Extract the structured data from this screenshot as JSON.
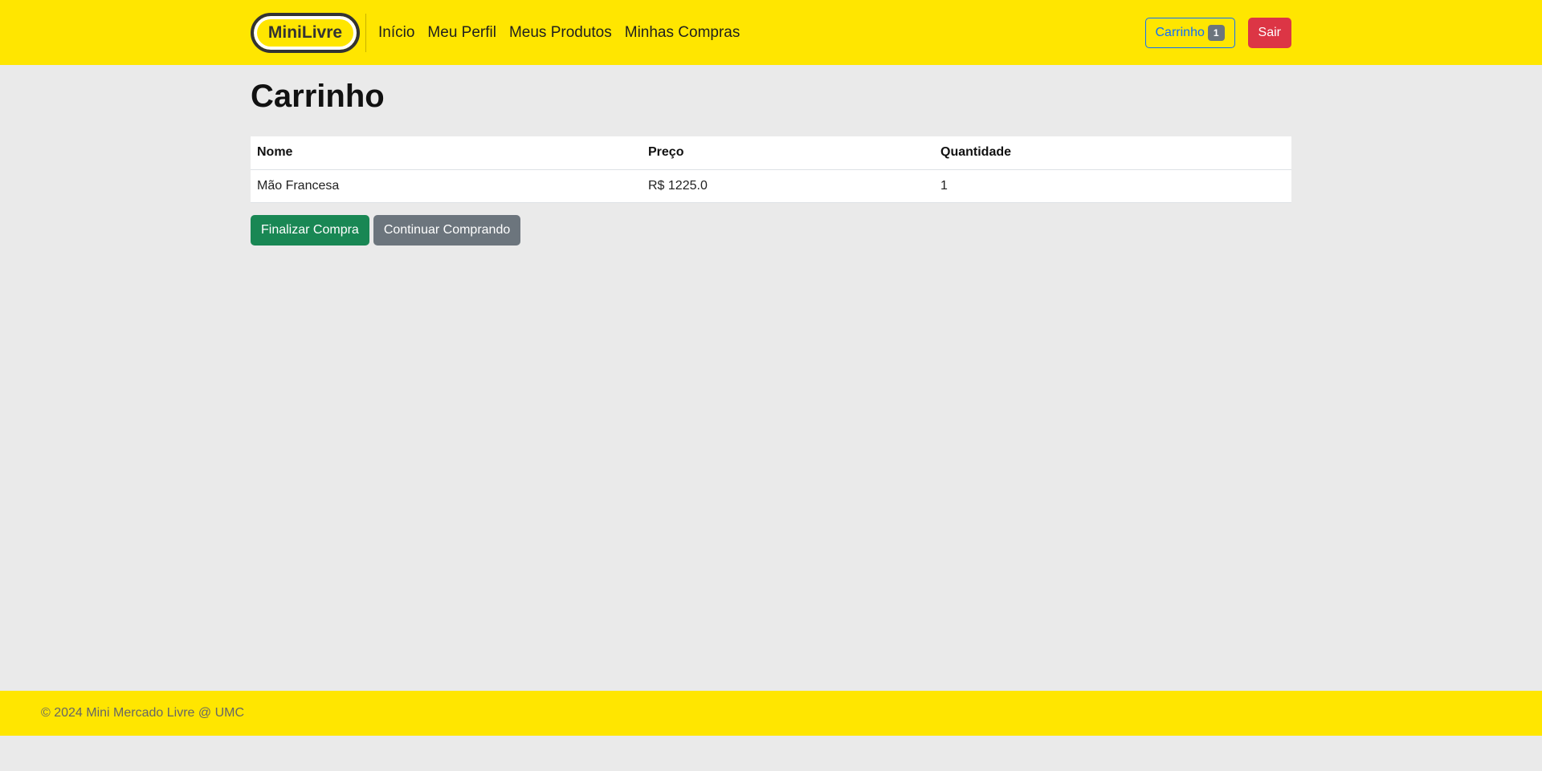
{
  "header": {
    "logo_text": "MiniLivre",
    "nav": [
      "Início",
      "Meu Perfil",
      "Meus Produtos",
      "Minhas Compras"
    ],
    "cart_label": "Carrinho",
    "cart_count": "1",
    "logout_label": "Sair"
  },
  "main": {
    "title": "Carrinho",
    "table": {
      "headers": [
        "Nome",
        "Preço",
        "Quantidade"
      ],
      "rows": [
        [
          "Mão Francesa",
          "R$ 1225.0",
          "1"
        ]
      ]
    },
    "finish_label": "Finalizar Compra",
    "continue_label": "Continuar Comprando"
  },
  "footer": {
    "text": "© 2024 Mini Mercado Livre @ UMC"
  },
  "colors": {
    "brand_yellow": "#ffe600",
    "primary": "#0d6efd",
    "danger": "#dc3545",
    "success": "#198754",
    "secondary": "#6c757d"
  }
}
